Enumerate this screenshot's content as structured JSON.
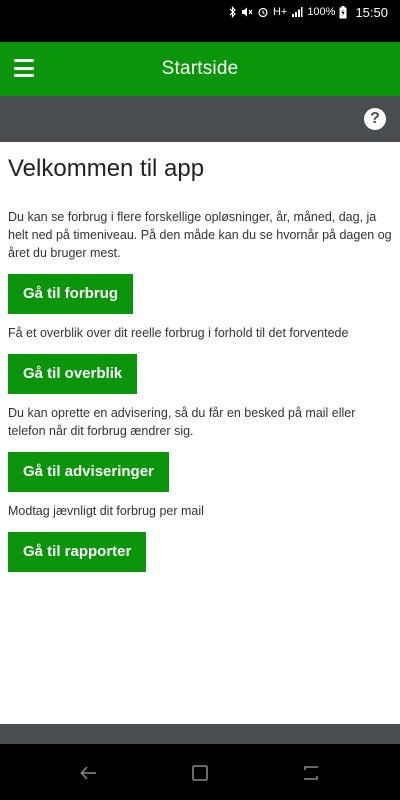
{
  "status_bar": {
    "signal_label": "H+",
    "battery": "100%",
    "time": "15:50"
  },
  "app_bar": {
    "title": "Startside"
  },
  "main": {
    "heading": "Velkommen til app",
    "sections": [
      {
        "description": "Du kan se forbrug i flere forskellige opløsninger, år, måned, dag, ja helt ned på timeniveau. På den måde kan du se hvornår på dagen og året du bruger mest.",
        "button_label": "Gå til forbrug"
      },
      {
        "description": "Få et overblik over dit reelle forbrug i forhold til det forventede",
        "button_label": "Gå til overblik"
      },
      {
        "description": "Du kan oprette en advisering, så du får en besked på mail eller telefon når dit forbrug ændrer sig.",
        "button_label": "Gå til adviseringer"
      },
      {
        "description": "Modtag jævnligt dit forbrug per mail",
        "button_label": "Gå til rapporter"
      }
    ]
  },
  "colors": {
    "brand_green": "#0a950a",
    "toolbar_gray": "#4a4d50"
  }
}
